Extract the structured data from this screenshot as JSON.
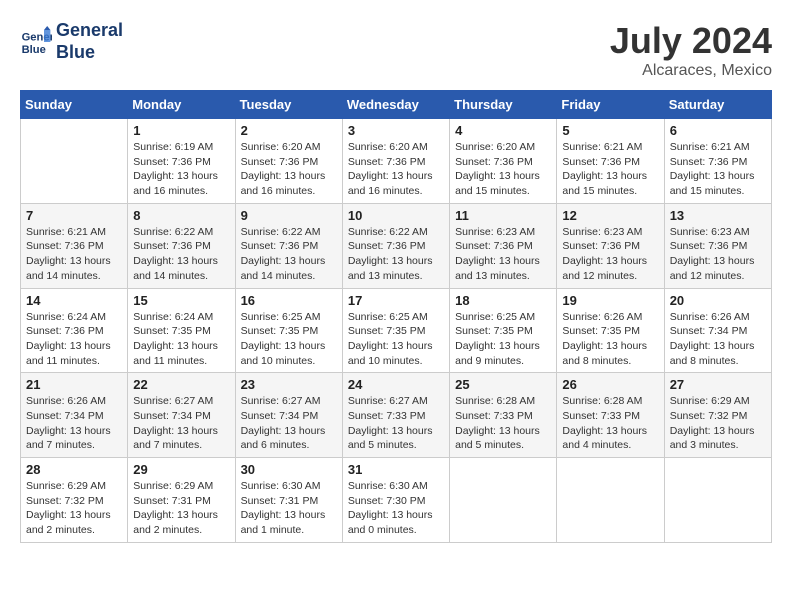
{
  "header": {
    "logo_line1": "General",
    "logo_line2": "Blue",
    "month_title": "July 2024",
    "location": "Alcaraces, Mexico"
  },
  "days_of_week": [
    "Sunday",
    "Monday",
    "Tuesday",
    "Wednesday",
    "Thursday",
    "Friday",
    "Saturday"
  ],
  "weeks": [
    [
      {
        "day": "",
        "info": ""
      },
      {
        "day": "1",
        "info": "Sunrise: 6:19 AM\nSunset: 7:36 PM\nDaylight: 13 hours\nand 16 minutes."
      },
      {
        "day": "2",
        "info": "Sunrise: 6:20 AM\nSunset: 7:36 PM\nDaylight: 13 hours\nand 16 minutes."
      },
      {
        "day": "3",
        "info": "Sunrise: 6:20 AM\nSunset: 7:36 PM\nDaylight: 13 hours\nand 16 minutes."
      },
      {
        "day": "4",
        "info": "Sunrise: 6:20 AM\nSunset: 7:36 PM\nDaylight: 13 hours\nand 15 minutes."
      },
      {
        "day": "5",
        "info": "Sunrise: 6:21 AM\nSunset: 7:36 PM\nDaylight: 13 hours\nand 15 minutes."
      },
      {
        "day": "6",
        "info": "Sunrise: 6:21 AM\nSunset: 7:36 PM\nDaylight: 13 hours\nand 15 minutes."
      }
    ],
    [
      {
        "day": "7",
        "info": "Sunrise: 6:21 AM\nSunset: 7:36 PM\nDaylight: 13 hours\nand 14 minutes."
      },
      {
        "day": "8",
        "info": "Sunrise: 6:22 AM\nSunset: 7:36 PM\nDaylight: 13 hours\nand 14 minutes."
      },
      {
        "day": "9",
        "info": "Sunrise: 6:22 AM\nSunset: 7:36 PM\nDaylight: 13 hours\nand 14 minutes."
      },
      {
        "day": "10",
        "info": "Sunrise: 6:22 AM\nSunset: 7:36 PM\nDaylight: 13 hours\nand 13 minutes."
      },
      {
        "day": "11",
        "info": "Sunrise: 6:23 AM\nSunset: 7:36 PM\nDaylight: 13 hours\nand 13 minutes."
      },
      {
        "day": "12",
        "info": "Sunrise: 6:23 AM\nSunset: 7:36 PM\nDaylight: 13 hours\nand 12 minutes."
      },
      {
        "day": "13",
        "info": "Sunrise: 6:23 AM\nSunset: 7:36 PM\nDaylight: 13 hours\nand 12 minutes."
      }
    ],
    [
      {
        "day": "14",
        "info": "Sunrise: 6:24 AM\nSunset: 7:36 PM\nDaylight: 13 hours\nand 11 minutes."
      },
      {
        "day": "15",
        "info": "Sunrise: 6:24 AM\nSunset: 7:35 PM\nDaylight: 13 hours\nand 11 minutes."
      },
      {
        "day": "16",
        "info": "Sunrise: 6:25 AM\nSunset: 7:35 PM\nDaylight: 13 hours\nand 10 minutes."
      },
      {
        "day": "17",
        "info": "Sunrise: 6:25 AM\nSunset: 7:35 PM\nDaylight: 13 hours\nand 10 minutes."
      },
      {
        "day": "18",
        "info": "Sunrise: 6:25 AM\nSunset: 7:35 PM\nDaylight: 13 hours\nand 9 minutes."
      },
      {
        "day": "19",
        "info": "Sunrise: 6:26 AM\nSunset: 7:35 PM\nDaylight: 13 hours\nand 8 minutes."
      },
      {
        "day": "20",
        "info": "Sunrise: 6:26 AM\nSunset: 7:34 PM\nDaylight: 13 hours\nand 8 minutes."
      }
    ],
    [
      {
        "day": "21",
        "info": "Sunrise: 6:26 AM\nSunset: 7:34 PM\nDaylight: 13 hours\nand 7 minutes."
      },
      {
        "day": "22",
        "info": "Sunrise: 6:27 AM\nSunset: 7:34 PM\nDaylight: 13 hours\nand 7 minutes."
      },
      {
        "day": "23",
        "info": "Sunrise: 6:27 AM\nSunset: 7:34 PM\nDaylight: 13 hours\nand 6 minutes."
      },
      {
        "day": "24",
        "info": "Sunrise: 6:27 AM\nSunset: 7:33 PM\nDaylight: 13 hours\nand 5 minutes."
      },
      {
        "day": "25",
        "info": "Sunrise: 6:28 AM\nSunset: 7:33 PM\nDaylight: 13 hours\nand 5 minutes."
      },
      {
        "day": "26",
        "info": "Sunrise: 6:28 AM\nSunset: 7:33 PM\nDaylight: 13 hours\nand 4 minutes."
      },
      {
        "day": "27",
        "info": "Sunrise: 6:29 AM\nSunset: 7:32 PM\nDaylight: 13 hours\nand 3 minutes."
      }
    ],
    [
      {
        "day": "28",
        "info": "Sunrise: 6:29 AM\nSunset: 7:32 PM\nDaylight: 13 hours\nand 2 minutes."
      },
      {
        "day": "29",
        "info": "Sunrise: 6:29 AM\nSunset: 7:31 PM\nDaylight: 13 hours\nand 2 minutes."
      },
      {
        "day": "30",
        "info": "Sunrise: 6:30 AM\nSunset: 7:31 PM\nDaylight: 13 hours\nand 1 minute."
      },
      {
        "day": "31",
        "info": "Sunrise: 6:30 AM\nSunset: 7:30 PM\nDaylight: 13 hours\nand 0 minutes."
      },
      {
        "day": "",
        "info": ""
      },
      {
        "day": "",
        "info": ""
      },
      {
        "day": "",
        "info": ""
      }
    ]
  ]
}
